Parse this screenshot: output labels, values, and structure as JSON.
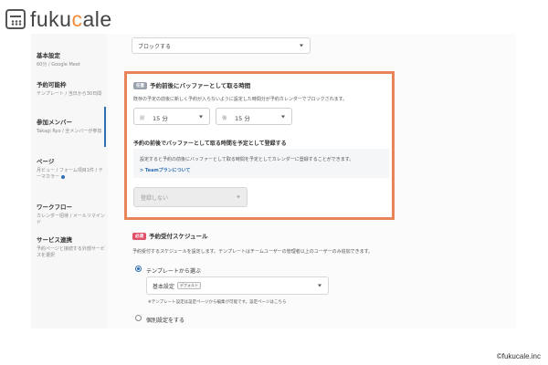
{
  "logo": {
    "text_main": "fuku",
    "text_accent": "c",
    "text_end": "ale"
  },
  "sidebar": {
    "items": [
      {
        "title": "基本設定",
        "sub": "60分 / Google Meet"
      },
      {
        "title": "予約可能枠",
        "sub": "テンプレート / 当日から30日間"
      },
      {
        "title": "参加メンバー",
        "sub": "Takagi Ryo / 全メンバーが参加"
      },
      {
        "title": "ページ",
        "sub": "月ビュー / フォーム項目1件 / テーマカラー"
      },
      {
        "title": "ワークフロー",
        "sub": "カレンダー招待 / メールリマインド"
      },
      {
        "title": "サービス連携",
        "sub": "予約ページと接続する外部サービスを選択"
      }
    ]
  },
  "top_select": {
    "value": "ブロックする"
  },
  "buffer": {
    "badge": "任意",
    "title": "予約前後にバッファーとして取る時間",
    "description": "既存の予定の前後に新しく予約が入らないように設定した時間分が予約カレンダーでブロックされます。",
    "before": {
      "prefix": "前",
      "value": "15 分"
    },
    "after": {
      "prefix": "後",
      "value": "15 分"
    },
    "register_title": "予約の前後でバッファーとして取る時間を予定として登録する",
    "register_desc": "設定すると予約の前後にバッファーとして取る時間を予定としてカレンダーに登録することができます。",
    "team_link": "> Teamプランについて",
    "register_select": "登録しない"
  },
  "schedule": {
    "badge": "必須",
    "title": "予約受付スケジュール",
    "description": "予約受付するスケジュールを設定します。テンプレートはチームユーザーの管理者以上のユーザーのみ追加できます。",
    "option_template": "テンプレートから選ぶ",
    "template_value": "基本設定",
    "template_badge": "デフォルト",
    "template_note": "※テンプレート設定は設定ページから編集が可能です。設定ページはこちら",
    "option_individual": "個別設定をする"
  },
  "copyright": "©fukucale.inc"
}
